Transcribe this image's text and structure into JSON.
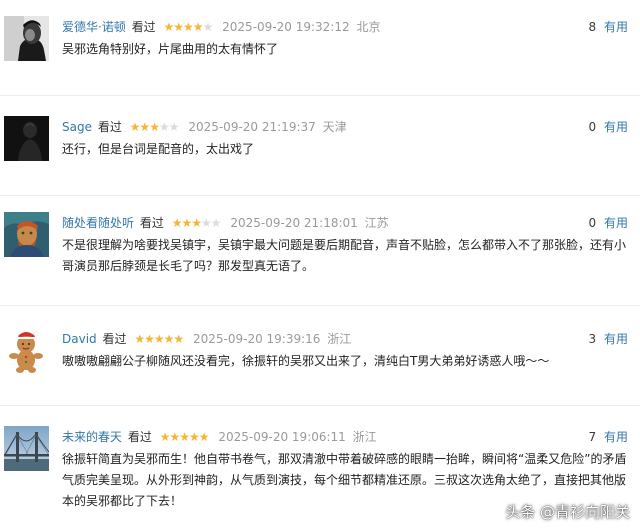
{
  "comments": [
    {
      "user": "爱德华·诺顿",
      "watched": "看过",
      "rating": 4,
      "time": "2025-09-20 19:32:12",
      "location": "北京",
      "votes": "8",
      "vote_label": "有用",
      "text": "吴邪选角特别好，片尾曲用的太有情怀了",
      "avatar": "bw-portrait"
    },
    {
      "user": "Sage",
      "watched": "看过",
      "rating": 3,
      "time": "2025-09-20 21:19:37",
      "location": "天津",
      "votes": "0",
      "vote_label": "有用",
      "text": "还行，但是台词是配音的，太出戏了",
      "avatar": "dark-figure"
    },
    {
      "user": "随处看随处听",
      "watched": "看过",
      "rating": 3,
      "time": "2025-09-20 21:18:01",
      "location": "江苏",
      "votes": "0",
      "vote_label": "有用",
      "text": "不是很理解为啥要找吴镇宇，吴镇宇最大问题是要后期配音，声音不贴脸，怎么都带入不了那张脸，还有小哥演员那后脖颈是长毛了吗？那发型真无语了。",
      "avatar": "van-gogh"
    },
    {
      "user": "David",
      "watched": "看过",
      "rating": 5,
      "time": "2025-09-20 19:39:16",
      "location": "浙江",
      "votes": "3",
      "vote_label": "有用",
      "text": "嗷嗷嗷翩翩公子柳随风还没看完，徐振轩的吴邪又出来了，清纯白T男大弟弟好诱惑人哦～～",
      "avatar": "gingerbread"
    },
    {
      "user": "未来的春天",
      "watched": "看过",
      "rating": 5,
      "time": "2025-09-20 19:06:11",
      "location": "浙江",
      "votes": "7",
      "vote_label": "有用",
      "text": "徐振轩简直为吴邪而生！他自带书卷气，那双清澈中带着破碎感的眼睛一抬眸，瞬间将“温柔又危险”的矛盾气质完美呈现。从外形到神韵，从气质到演技，每个细节都精准还原。三叔这次选角太绝了，直接把其他版本的吴邪都比了下去！",
      "avatar": "bridge"
    }
  ],
  "watermark": "头条 @青衫向阳关",
  "colors": {
    "username": "#3377aa",
    "star_on": "#f6b532",
    "star_off": "#dcdcdc",
    "meta_gray": "#9a9a9a"
  }
}
